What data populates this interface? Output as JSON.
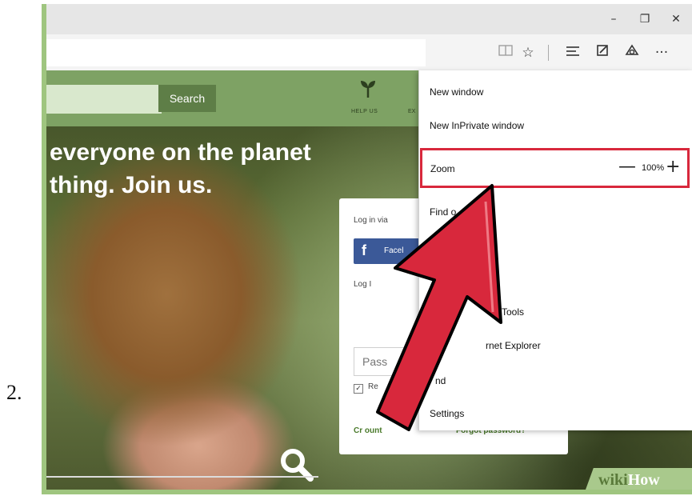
{
  "step_number": "2.",
  "window": {
    "minimize": "–",
    "maximize": "❐",
    "close": "✕"
  },
  "toolbar": {
    "reading_view_icon": "book-icon",
    "favorite_icon": "star-icon",
    "hub_icon": "hub-icon",
    "note_icon": "web-note-icon",
    "share_icon": "share-icon",
    "more_icon": "more-icon"
  },
  "site": {
    "search_button": "Search",
    "nav_help": "HELP US",
    "nav_ex": "EX",
    "hero_line1": "everyone on the planet",
    "hero_line2": "thing. Join us."
  },
  "login": {
    "log_in_via": "Log in via",
    "facebook": "Facel",
    "log_in": "Log I",
    "password_placeholder": "Pass",
    "remember": "Re",
    "create_account": "Cr              ount",
    "forgot_password": "Forgot password?"
  },
  "menu": {
    "new_window": "New window",
    "new_inprivate": "New InPrivate window",
    "zoom_label": "Zoom",
    "zoom_minus": "—",
    "zoom_value": "100%",
    "zoom_plus": "+",
    "find": "Find o",
    "dev_tools": "Tools",
    "open_ie": "rnet Explorer",
    "pin": "nd",
    "settings": "Settings"
  },
  "colors": {
    "highlight": "#d8283c",
    "arrow": "#d8283c",
    "site_green": "#7ea264"
  },
  "watermark": {
    "wiki": "wiki",
    "how": "How"
  }
}
